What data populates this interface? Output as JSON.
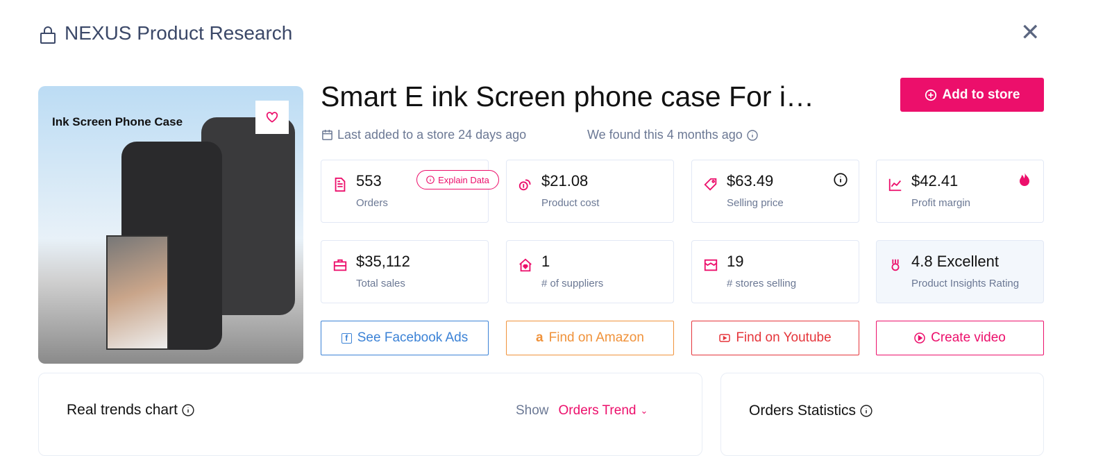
{
  "header": {
    "title": "NEXUS Product Research",
    "close_icon": "close-icon"
  },
  "product": {
    "image_text": "Ink Screen Phone Case",
    "title": "Smart E ink Screen phone case For i…",
    "last_added": "Last added to a store 24 days ago",
    "found": "We found this 4 months ago",
    "add_button": "Add to store"
  },
  "stats": [
    {
      "value": "553",
      "label": "Orders",
      "icon": "document-icon"
    },
    {
      "value": "$21.08",
      "label": "Product cost",
      "icon": "coins-icon"
    },
    {
      "value": "$63.49",
      "label": "Selling price",
      "icon": "tag-icon"
    },
    {
      "value": "$42.41",
      "label": "Profit margin",
      "icon": "chart-line-icon"
    },
    {
      "value": "$35,112",
      "label": "Total sales",
      "icon": "briefcase-icon"
    },
    {
      "value": "1",
      "label": "# of suppliers",
      "icon": "house-heart-icon"
    },
    {
      "value": "19",
      "label": "# stores selling",
      "icon": "store-icon"
    },
    {
      "value": "4.8 Excellent",
      "label": "Product Insights Rating",
      "icon": "award-icon"
    }
  ],
  "explain_label": "Explain Data",
  "actions": [
    {
      "label": "See Facebook Ads",
      "color": "#3b82d6"
    },
    {
      "label": "Find on Amazon",
      "color": "#f0923a"
    },
    {
      "label": "Find on Youtube",
      "color": "#e5343a"
    },
    {
      "label": "Create video",
      "color": "#ec0f6b"
    }
  ],
  "trends": {
    "title": "Real trends chart",
    "show_label": "Show",
    "selected": "Orders Trend"
  },
  "orders_stats": {
    "title": "Orders Statistics"
  },
  "colors": {
    "accent": "#ec0f6b",
    "muted": "#6b7894"
  }
}
